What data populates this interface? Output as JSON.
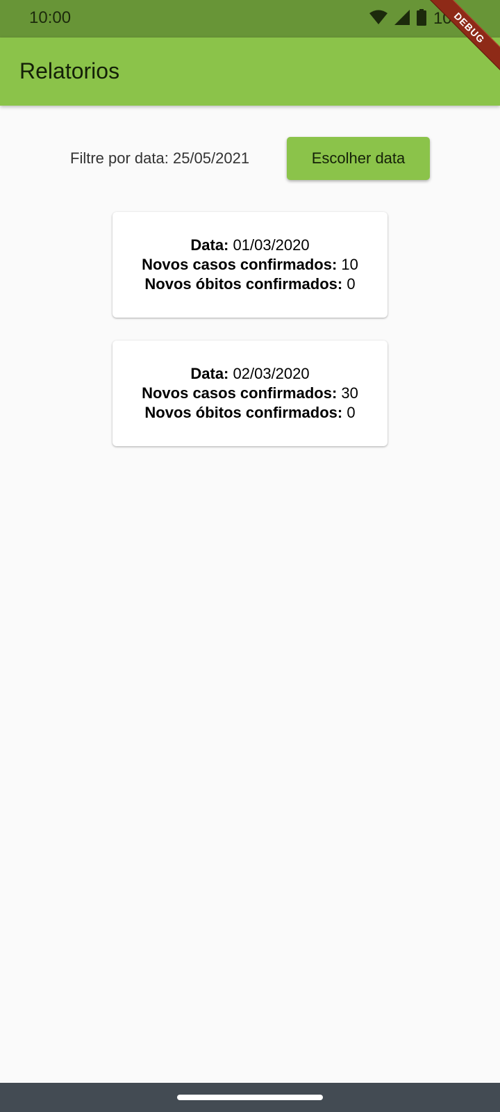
{
  "status_bar": {
    "time": "10:00",
    "battery": "100",
    "icons": [
      "wifi-icon",
      "signal-icon",
      "battery-icon"
    ],
    "color": "#689537"
  },
  "debug_banner": "DEBUG",
  "app_bar": {
    "title": "Relatorios",
    "color": "#8bc34a"
  },
  "filter": {
    "label": "Filtre por data: 25/05/2021",
    "button_label": "Escolher data"
  },
  "reports": [
    {
      "date_label": "Data:",
      "date": "01/03/2020",
      "cases_label": "Novos casos confirmados:",
      "cases": "10",
      "deaths_label": "Novos óbitos confirmados:",
      "deaths": "0"
    },
    {
      "date_label": "Data:",
      "date": "02/03/2020",
      "cases_label": "Novos casos confirmados:",
      "cases": "30",
      "deaths_label": "Novos óbitos confirmados:",
      "deaths": "0"
    }
  ]
}
